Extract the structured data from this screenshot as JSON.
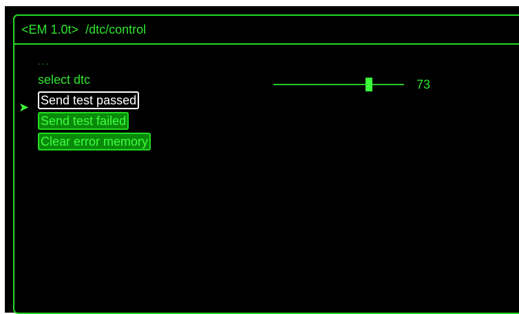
{
  "header": {
    "device": "<EM 1.0t>",
    "path": "/dtc/control"
  },
  "menu": {
    "ellipsis": "...",
    "select_label": "select dtc",
    "items": [
      {
        "label": "Send test passed",
        "selected": true
      },
      {
        "label": "Send test failed",
        "selected": false
      },
      {
        "label": "Clear error memory",
        "selected": false
      }
    ]
  },
  "slider": {
    "value": "73",
    "min": 0,
    "max": 100
  },
  "colors": {
    "accent": "#22dd22",
    "background": "#000000",
    "selected": "#ffffff",
    "button_fill": "#0a8a0a"
  },
  "icons": {
    "pointer": "arrow-right-icon"
  }
}
